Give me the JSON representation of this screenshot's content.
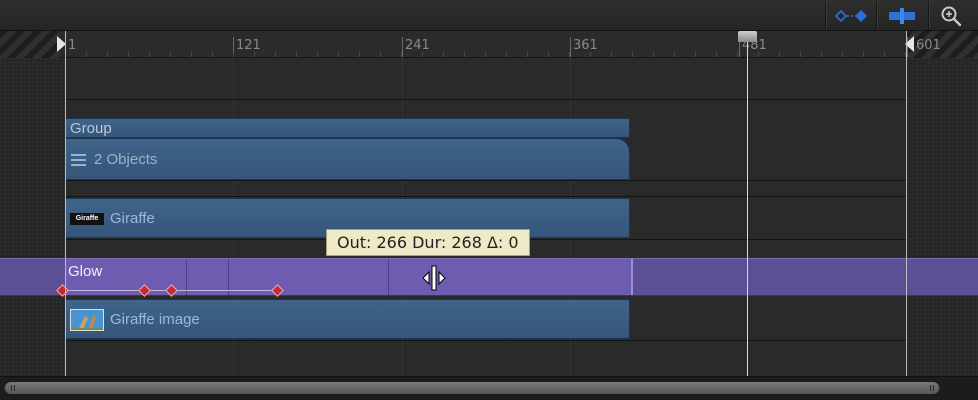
{
  "toolbar": {
    "keyframe_icon": "keyframe-diamonds-icon",
    "snap_icon": "snap-icon",
    "zoom_icon": "zoom-icon"
  },
  "ruler": {
    "ticks": [
      "1",
      "121",
      "241",
      "361",
      "481",
      "601"
    ]
  },
  "tracks": {
    "group_label": "Group",
    "objects_label": "2 Objects",
    "giraffe_thumb": "Giraffe",
    "giraffe_label": "Giraffe",
    "glow_label": "Glow",
    "giraffe_image_label": "Giraffe image"
  },
  "tooltip": {
    "text": "Out: 266 Dur: 268 Δ: 0"
  },
  "colors": {
    "accent": "#2f6fd6",
    "bar": "#3a5b7f",
    "glow": "#6d5cb0",
    "keyframe": "#c12c36"
  }
}
